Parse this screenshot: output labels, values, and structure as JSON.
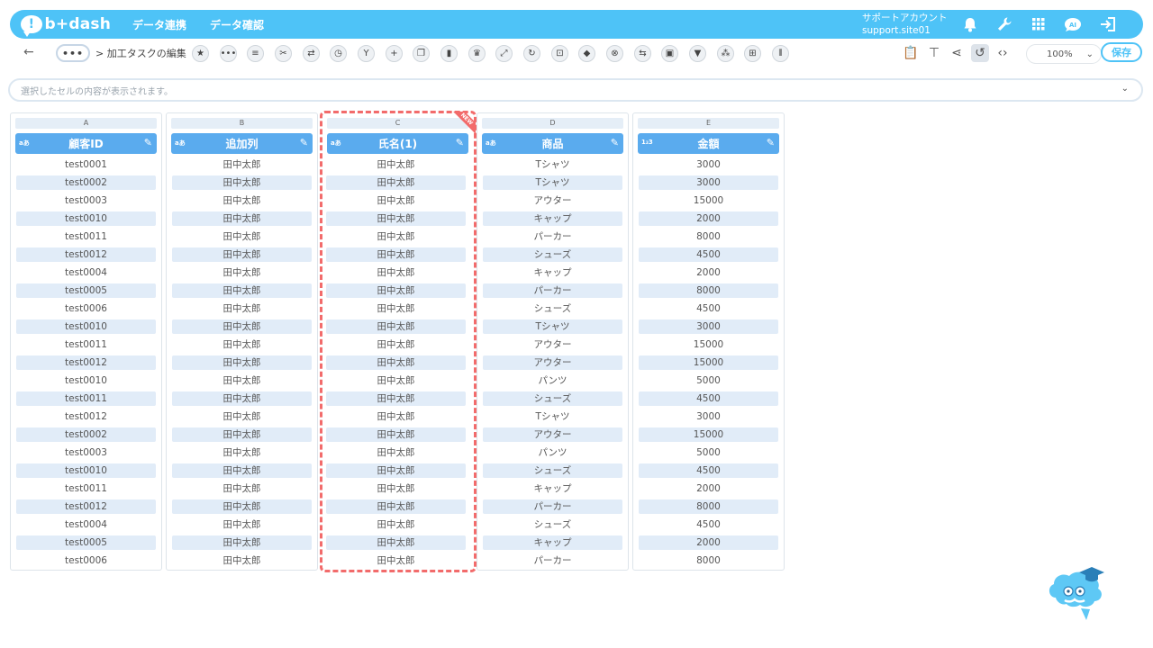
{
  "header": {
    "logo_mark": "!",
    "logo_text": "b+dash",
    "nav": [
      "データ連携",
      "データ確認"
    ],
    "account_label": "サポートアカウント",
    "account_site": "support.site01",
    "icons": [
      "bell-icon",
      "wrench-icon",
      "apps-grid-icon",
      "chat-bubble-icon",
      "logout-icon"
    ],
    "chat_badge": "AI"
  },
  "toolbar": {
    "back_icon": "arrow-left-icon",
    "dots": "•••",
    "breadcrumb": "> 加工タスクの編集",
    "tools": [
      "star-icon",
      "more-icon",
      "list-icon",
      "scissors-icon",
      "swap-icon",
      "timer-icon",
      "branch-icon",
      "plus-icon",
      "copy-icon",
      "trash-icon",
      "crown-icon",
      "expand-icon",
      "refresh-icon",
      "lock-icon",
      "box-icon",
      "cancel-icon",
      "exchange-icon",
      "frame-icon",
      "filter-icon",
      "group-icon",
      "grid-icon",
      "columns-icon"
    ],
    "right_tools": [
      "clipboard-icon",
      "hierarchy-icon",
      "share-icon",
      "history-icon",
      "code-icon"
    ],
    "zoom": "100%",
    "save": "保存"
  },
  "cell_bar": {
    "placeholder": "選択したセルの内容が表示されます。"
  },
  "columns": [
    {
      "letter": "A",
      "type": "aあ",
      "name": "顧客ID",
      "values": [
        "test0001",
        "test0002",
        "test0003",
        "test0010",
        "test0011",
        "test0012",
        "test0004",
        "test0005",
        "test0006",
        "test0010",
        "test0011",
        "test0012",
        "test0010",
        "test0011",
        "test0012",
        "test0002",
        "test0003",
        "test0010",
        "test0011",
        "test0012",
        "test0004",
        "test0005",
        "test0006"
      ]
    },
    {
      "letter": "B",
      "type": "aあ",
      "name": "追加列",
      "values": [
        "田中太郎",
        "田中太郎",
        "田中太郎",
        "田中太郎",
        "田中太郎",
        "田中太郎",
        "田中太郎",
        "田中太郎",
        "田中太郎",
        "田中太郎",
        "田中太郎",
        "田中太郎",
        "田中太郎",
        "田中太郎",
        "田中太郎",
        "田中太郎",
        "田中太郎",
        "田中太郎",
        "田中太郎",
        "田中太郎",
        "田中太郎",
        "田中太郎",
        "田中太郎"
      ]
    },
    {
      "letter": "C",
      "type": "aあ",
      "name": "氏名(1)",
      "badge": "NEW",
      "selected": true,
      "values": [
        "田中太郎",
        "田中太郎",
        "田中太郎",
        "田中太郎",
        "田中太郎",
        "田中太郎",
        "田中太郎",
        "田中太郎",
        "田中太郎",
        "田中太郎",
        "田中太郎",
        "田中太郎",
        "田中太郎",
        "田中太郎",
        "田中太郎",
        "田中太郎",
        "田中太郎",
        "田中太郎",
        "田中太郎",
        "田中太郎",
        "田中太郎",
        "田中太郎",
        "田中太郎"
      ]
    },
    {
      "letter": "D",
      "type": "aあ",
      "name": "商品",
      "values": [
        "Tシャツ",
        "Tシャツ",
        "アウター",
        "キャップ",
        "パーカー",
        "シューズ",
        "キャップ",
        "パーカー",
        "シューズ",
        "Tシャツ",
        "アウター",
        "アウター",
        "パンツ",
        "シューズ",
        "Tシャツ",
        "アウター",
        "パンツ",
        "シューズ",
        "キャップ",
        "パーカー",
        "シューズ",
        "キャップ",
        "パーカー"
      ]
    },
    {
      "letter": "E",
      "type": "1₂3",
      "name": "金額",
      "values": [
        "3000",
        "3000",
        "15000",
        "2000",
        "8000",
        "4500",
        "2000",
        "8000",
        "4500",
        "3000",
        "15000",
        "15000",
        "5000",
        "4500",
        "3000",
        "15000",
        "5000",
        "4500",
        "2000",
        "8000",
        "4500",
        "2000",
        "8000"
      ]
    }
  ],
  "mascot": "mascot-graduate-icon"
}
